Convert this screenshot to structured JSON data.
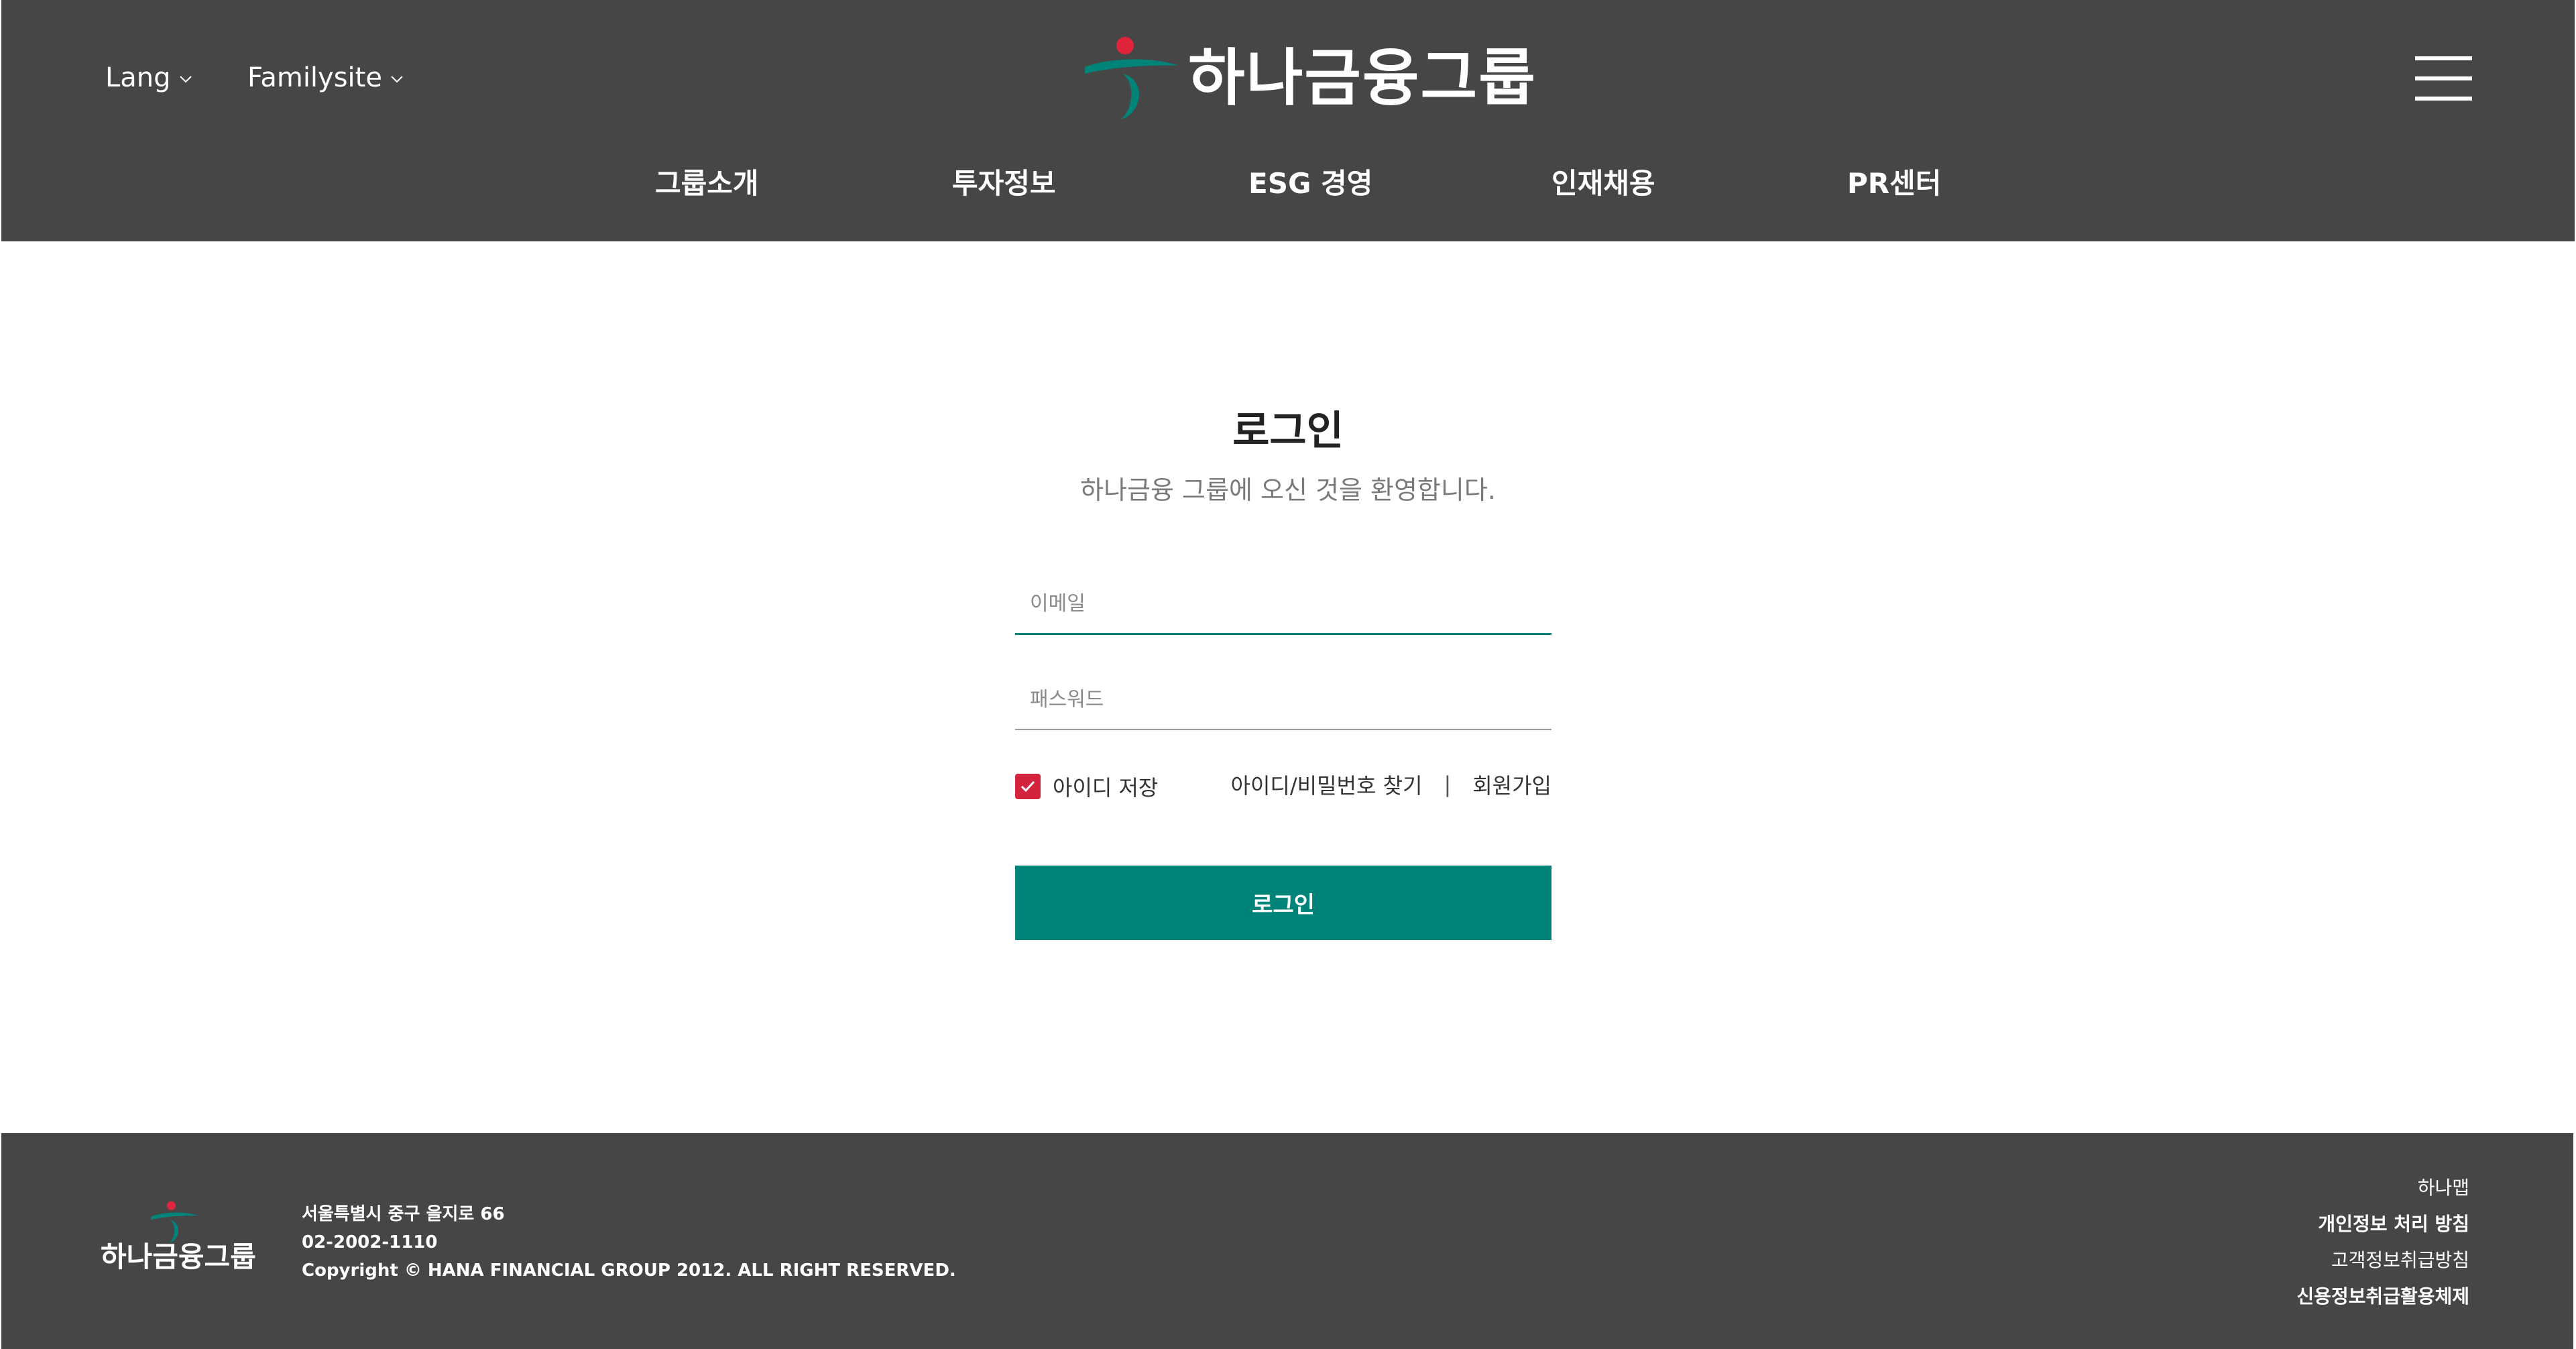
{
  "header": {
    "lang_label": "Lang",
    "familysite_label": "Familysite",
    "logo_text": "하나금융그룹",
    "nav": [
      {
        "label": "그룹소개"
      },
      {
        "label": "투자정보"
      },
      {
        "label": "ESG 경영"
      },
      {
        "label": "인재채용"
      },
      {
        "label": "PR센터"
      }
    ]
  },
  "login": {
    "title": "로그인",
    "subtitle": "하나금융 그룹에 오신 것을 환영합니다.",
    "email_placeholder": "이메일",
    "password_placeholder": "패스워드",
    "remember_label": "아이디 저장",
    "remember_checked": true,
    "find_label": "아이디/비밀번호 찾기",
    "separator": "|",
    "signup_label": "회원가입",
    "submit_label": "로그인"
  },
  "footer": {
    "logo_text": "하나금융그룹",
    "address": "서울특별시 중구 을지로 66",
    "phone": "02-2002-1110",
    "copyright": "Copyright © HANA FINANCIAL GROUP 2012. ALL RIGHT RESERVED.",
    "links": [
      {
        "label": "하나맵"
      },
      {
        "label": "개인정보 처리 방침"
      },
      {
        "label": "고객정보취급방침"
      },
      {
        "label": "신용정보취급활용체제"
      }
    ]
  },
  "colors": {
    "header_bg": "#464646",
    "accent_green": "#00847a",
    "checkbox_red": "#d4233c",
    "logo_red": "#e1233b"
  }
}
